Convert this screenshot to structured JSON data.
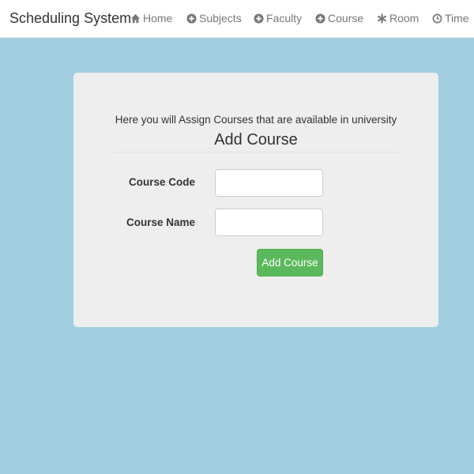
{
  "navbar": {
    "brand": "Scheduling System",
    "items": [
      {
        "label": "Home",
        "icon": "home-icon"
      },
      {
        "label": "Subjects",
        "icon": "plus-circle-icon"
      },
      {
        "label": "Faculty",
        "icon": "plus-circle-icon"
      },
      {
        "label": "Course",
        "icon": "plus-circle-icon"
      },
      {
        "label": "Room",
        "icon": "asterisk-icon"
      },
      {
        "label": "Time",
        "icon": "clock-icon"
      }
    ]
  },
  "form": {
    "intro": "Here you will Assign Courses that are available in university",
    "title": "Add Course",
    "fields": [
      {
        "label": "Course Code",
        "value": "",
        "placeholder": ""
      },
      {
        "label": "Course Name",
        "value": "",
        "placeholder": ""
      }
    ],
    "submit_label": "Add Course"
  },
  "colors": {
    "background": "#a1cfdf",
    "navbar": "#ffffff",
    "card": "#eeeeee",
    "submit": "#5cb85c",
    "nav_text": "#777777"
  }
}
